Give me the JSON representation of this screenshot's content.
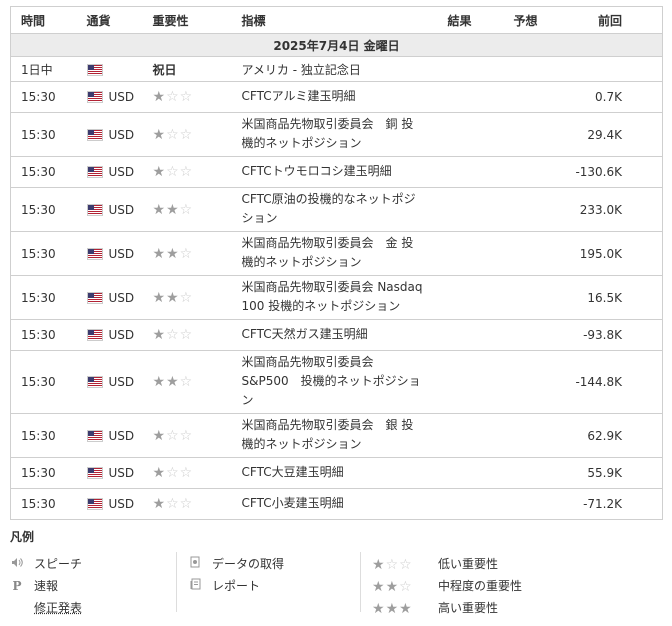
{
  "headers": {
    "time": "時間",
    "currency": "通貨",
    "importance": "重要性",
    "event": "指標",
    "actual": "結果",
    "forecast": "予想",
    "previous": "前回"
  },
  "date_label": "2025年7月4日 金曜日",
  "holiday": {
    "time": "1日中",
    "label": "祝日",
    "event": "アメリカ - 独立記念日"
  },
  "events": [
    {
      "time": "15:30",
      "currency": "USD",
      "importance": 1,
      "event": "CFTCアルミ建玉明細",
      "actual": "",
      "forecast": "",
      "previous": "0.7K"
    },
    {
      "time": "15:30",
      "currency": "USD",
      "importance": 1,
      "event": "米国商品先物取引委員会　銅 投機的ネットポジション",
      "actual": "",
      "forecast": "",
      "previous": "29.4K"
    },
    {
      "time": "15:30",
      "currency": "USD",
      "importance": 1,
      "event": "CFTCトウモロコシ建玉明細",
      "actual": "",
      "forecast": "",
      "previous": "-130.6K"
    },
    {
      "time": "15:30",
      "currency": "USD",
      "importance": 2,
      "event": "CFTC原油の投機的なネットポジション",
      "actual": "",
      "forecast": "",
      "previous": "233.0K"
    },
    {
      "time": "15:30",
      "currency": "USD",
      "importance": 2,
      "event": "米国商品先物取引委員会　金 投機的ネットポジション",
      "actual": "",
      "forecast": "",
      "previous": "195.0K"
    },
    {
      "time": "15:30",
      "currency": "USD",
      "importance": 2,
      "event": "米国商品先物取引委員会 Nasdaq 100 投機的ネットポジション",
      "actual": "",
      "forecast": "",
      "previous": "16.5K"
    },
    {
      "time": "15:30",
      "currency": "USD",
      "importance": 1,
      "event": "CFTC天然ガス建玉明細",
      "actual": "",
      "forecast": "",
      "previous": "-93.8K"
    },
    {
      "time": "15:30",
      "currency": "USD",
      "importance": 2,
      "event": "米国商品先物取引委員会 S&P500　投機的ネットポジション",
      "actual": "",
      "forecast": "",
      "previous": "-144.8K"
    },
    {
      "time": "15:30",
      "currency": "USD",
      "importance": 1,
      "event": "米国商品先物取引委員会　銀 投機的ネットポジション",
      "actual": "",
      "forecast": "",
      "previous": "62.9K"
    },
    {
      "time": "15:30",
      "currency": "USD",
      "importance": 1,
      "event": "CFTC大豆建玉明細",
      "actual": "",
      "forecast": "",
      "previous": "55.9K"
    },
    {
      "time": "15:30",
      "currency": "USD",
      "importance": 1,
      "event": "CFTC小麦建玉明細",
      "actual": "",
      "forecast": "",
      "previous": "-71.2K"
    }
  ],
  "legend": {
    "title": "凡例",
    "speech": "スピーチ",
    "preliminary": "速報",
    "revised": "修正発表",
    "data_retrieval": "データの取得",
    "report": "レポート",
    "low": "低い重要性",
    "medium": "中程度の重要性",
    "high": "高い重要性"
  },
  "icons": {
    "speech": "speaker-icon",
    "preliminary": "p-letter-icon",
    "data_retrieval": "document-icon",
    "report": "report-icon",
    "flag": "us-flag-icon",
    "star": "star-icon"
  },
  "colors": {
    "star_on": "#9e9e9e",
    "star_off": "#cccccc",
    "date_row_bg": "#ececec",
    "border": "#cfcfcf"
  }
}
